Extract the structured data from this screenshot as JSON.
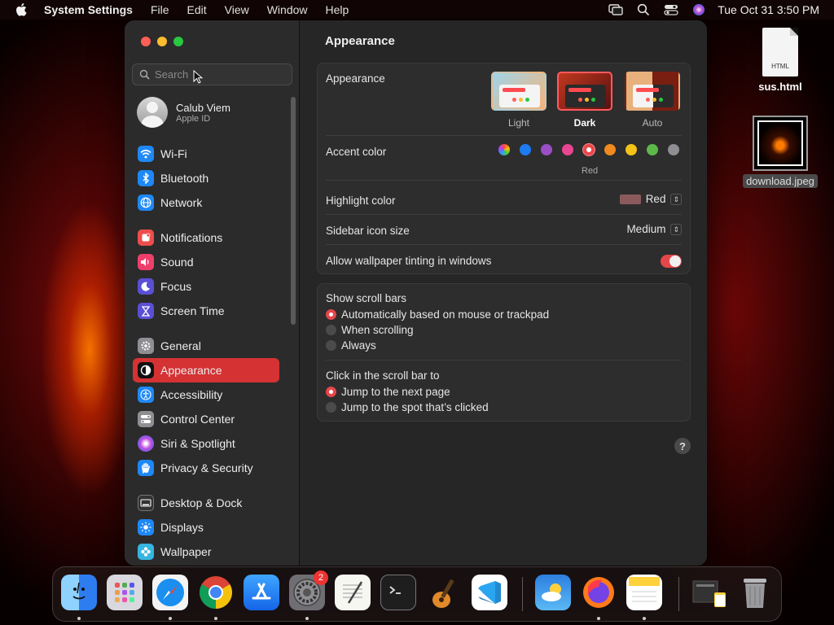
{
  "menubar": {
    "app_name": "System Settings",
    "menus": [
      "File",
      "Edit",
      "View",
      "Window",
      "Help"
    ],
    "clock": "Tue Oct 31  3:50 PM"
  },
  "desktop": {
    "icons": [
      {
        "label": "sus.html",
        "doc_text": "HTML"
      },
      {
        "label": "download.jpeg"
      }
    ]
  },
  "sidebar": {
    "search_placeholder": "Search",
    "account": {
      "name": "Calub Viem",
      "sub": "Apple ID"
    },
    "groups": [
      [
        {
          "label": "Wi-Fi",
          "icon": "wifi-icon",
          "color": "#1e88f5"
        },
        {
          "label": "Bluetooth",
          "icon": "bluetooth-icon",
          "color": "#1e88f5"
        },
        {
          "label": "Network",
          "icon": "globe-icon",
          "color": "#1e88f5"
        }
      ],
      [
        {
          "label": "Notifications",
          "icon": "bell-icon",
          "color": "#ef4d4d"
        },
        {
          "label": "Sound",
          "icon": "speaker-icon",
          "color": "#ee3f6a"
        },
        {
          "label": "Focus",
          "icon": "moon-icon",
          "color": "#5b4fd6"
        },
        {
          "label": "Screen Time",
          "icon": "hourglass-icon",
          "color": "#5b4fd6"
        }
      ],
      [
        {
          "label": "General",
          "icon": "gear-icon",
          "color": "#8e8e93"
        },
        {
          "label": "Appearance",
          "icon": "appearance-icon",
          "color": "#111111",
          "active": true
        },
        {
          "label": "Accessibility",
          "icon": "accessibility-icon",
          "color": "#1e88f5"
        },
        {
          "label": "Control Center",
          "icon": "control-center-icon",
          "color": "#8e8e93"
        },
        {
          "label": "Siri & Spotlight",
          "icon": "siri-icon",
          "color": "#a03cd6"
        },
        {
          "label": "Privacy & Security",
          "icon": "hand-icon",
          "color": "#1e88f5"
        }
      ],
      [
        {
          "label": "Desktop & Dock",
          "icon": "dock-icon",
          "color": "#333333"
        },
        {
          "label": "Displays",
          "icon": "sun-icon",
          "color": "#1e88f5"
        },
        {
          "label": "Wallpaper",
          "icon": "flower-icon",
          "color": "#36b5e0"
        }
      ]
    ]
  },
  "main": {
    "title": "Appearance",
    "appearance": {
      "label": "Appearance",
      "options": [
        {
          "label": "Light",
          "selected": false
        },
        {
          "label": "Dark",
          "selected": true
        },
        {
          "label": "Auto",
          "selected": false
        }
      ]
    },
    "accent": {
      "label": "Accent color",
      "selected_name": "Red",
      "colors": [
        "multicolor",
        "#1e7bf2",
        "#9b4fc4",
        "#e94592",
        "#e8474a",
        "#f08a1e",
        "#f5c318",
        "#5cb94a",
        "#8e8e93"
      ],
      "selected_index": 4
    },
    "highlight": {
      "label": "Highlight color",
      "value": "Red",
      "swatch": "#8a5a5c"
    },
    "sidebar_icon_size": {
      "label": "Sidebar icon size",
      "value": "Medium"
    },
    "wallpaper_tinting": {
      "label": "Allow wallpaper tinting in windows",
      "on": true
    },
    "scroll_bars": {
      "label": "Show scroll bars",
      "options": [
        "Automatically based on mouse or trackpad",
        "When scrolling",
        "Always"
      ],
      "selected_index": 0
    },
    "click_scroll": {
      "label": "Click in the scroll bar to",
      "options": [
        "Jump to the next page",
        "Jump to the spot that’s clicked"
      ],
      "selected_index": 0
    },
    "help_glyph": "?"
  },
  "dock": {
    "badge": "2",
    "apps": [
      "finder-icon",
      "launchpad-icon",
      "safari-icon",
      "chrome-icon",
      "app-store-icon",
      "system-settings-icon",
      "textedit-icon",
      "terminal-icon",
      "garageband-icon",
      "vscode-icon",
      "weather-icon",
      "firefox-icon",
      "notes-icon",
      "downloads-stack-icon",
      "trash-icon"
    ]
  }
}
